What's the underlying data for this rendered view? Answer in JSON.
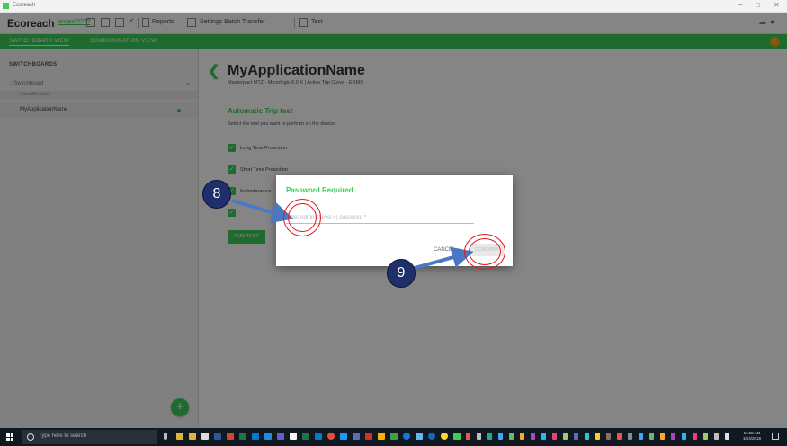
{
  "window": {
    "title": "Ecoreach"
  },
  "toolbar": {
    "brand": "Ecoreach",
    "project_link": "project????",
    "reports_label": "Reports",
    "settings_batch_label": "Settings Batch Transfer",
    "test_label": "Test"
  },
  "nav": {
    "tabs": [
      "SWITCHBOARD VIEW",
      "COMMUNICATION VIEW"
    ],
    "badge": "!"
  },
  "sidebar": {
    "header": "SWITCHBOARDS",
    "switchboard_label": "Switchboard",
    "group_label": "CircuitBreakers",
    "item_label": "MyApplicationName",
    "add_button": "+"
  },
  "main": {
    "back": "❮",
    "title": "MyApplicationName",
    "subtitle": "Masterpact MTZ - Micrologic 6.0 X   |   Active Trip Curve - ERMS",
    "section_title": "Automatic Trip test",
    "section_subtitle": "Select the test you want to perform on the device",
    "options": [
      "Long Time Protection",
      "Short Time Protection",
      "Instantaneous",
      ""
    ],
    "run_button": "RUN TEST"
  },
  "dialog": {
    "title": "Password Required",
    "input_placeholder": "Enter Admin (Level 4) password *",
    "cancel_label": "CANCEL",
    "confirm_label": "CONFIRM"
  },
  "annotations": {
    "step_a": "8",
    "step_b": "9"
  },
  "taskbar": {
    "search_placeholder": "Type here to search",
    "time": "11:58 AM",
    "date": "10/4/2018"
  },
  "colors": {
    "accent": "#3dcd58",
    "annotation_fill": "#1f2f6b",
    "annotation_ring": "#e21b1b",
    "arrow": "#4a78c4",
    "taskbar": "#101820"
  }
}
